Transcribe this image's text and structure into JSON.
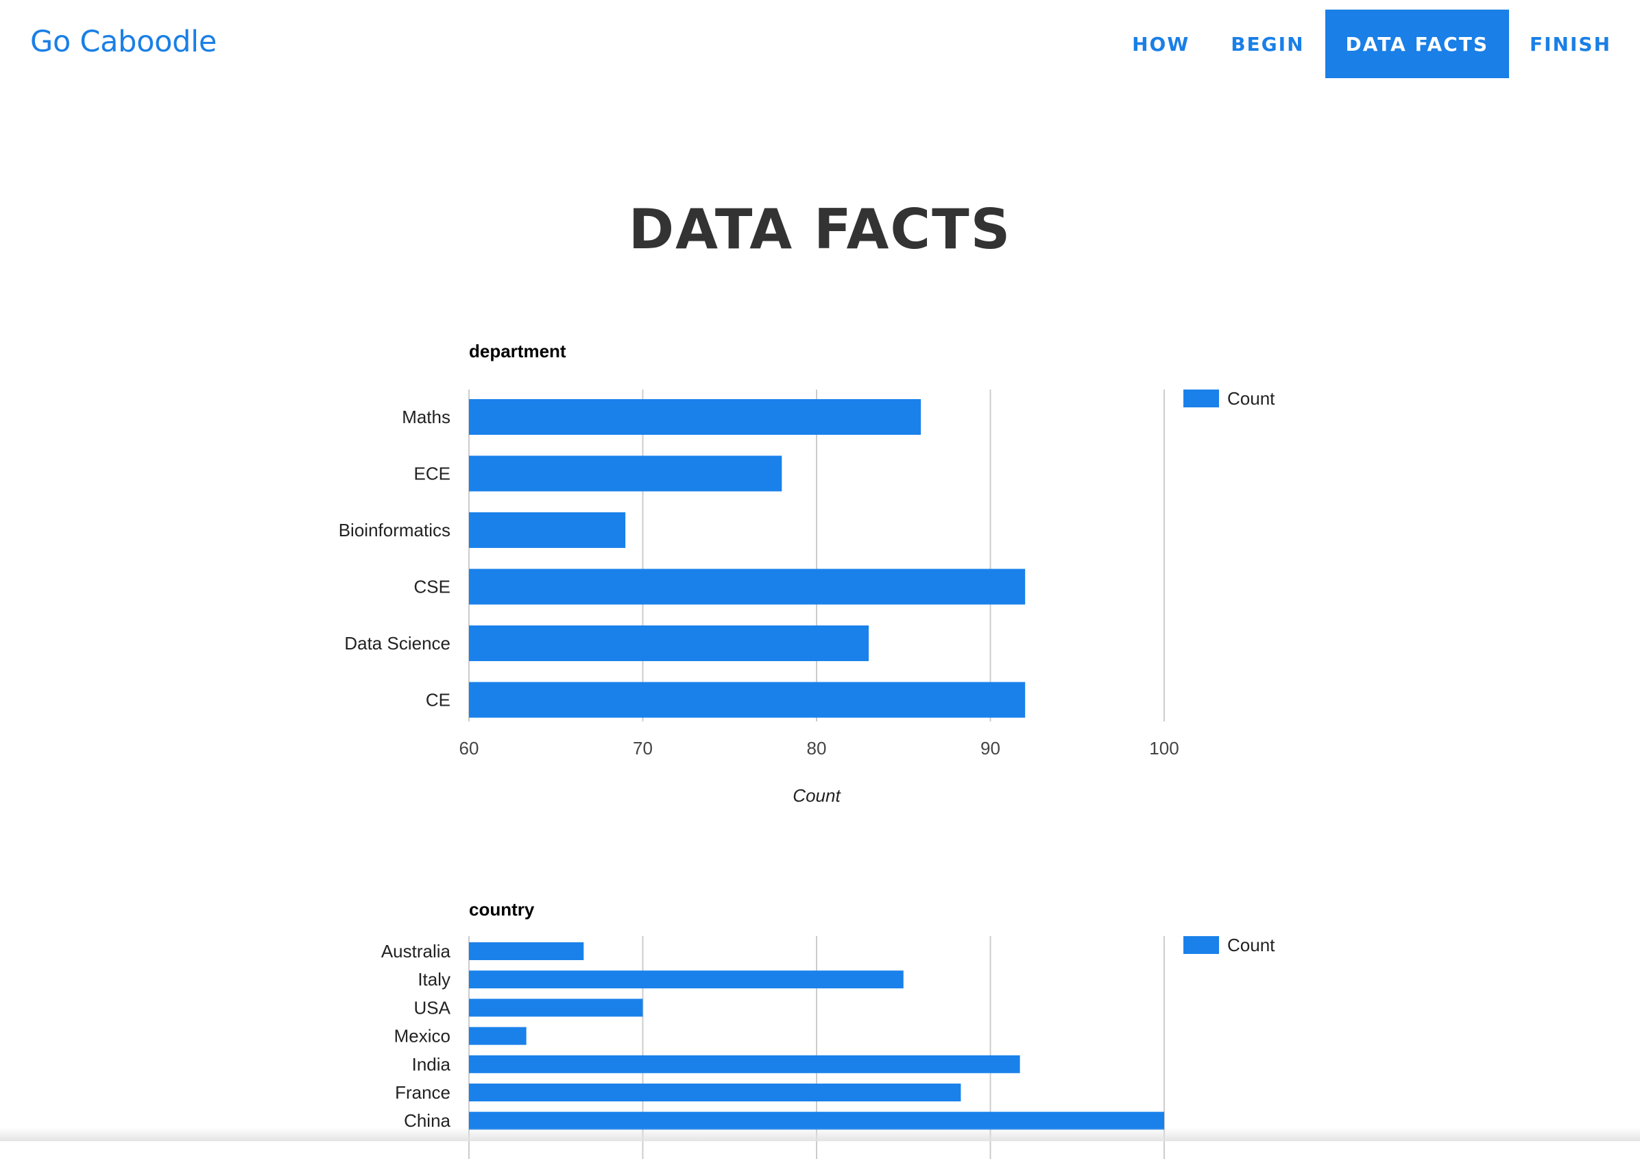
{
  "brand": "Go Caboodle",
  "nav": [
    {
      "label": "HOW",
      "active": false
    },
    {
      "label": "BEGIN",
      "active": false
    },
    {
      "label": "DATA FACTS",
      "active": true
    },
    {
      "label": "FINISH",
      "active": false
    }
  ],
  "page_title": "DATA FACTS",
  "colors": {
    "accent": "#1a7fe6",
    "bar": "#1a81ea",
    "grid": "#cccccc"
  },
  "chart_data": [
    {
      "type": "bar",
      "orientation": "horizontal",
      "title": "department",
      "categories": [
        "Maths",
        "ECE",
        "Bioinformatics",
        "CSE",
        "Data Science",
        "CE"
      ],
      "series": [
        {
          "name": "Count",
          "values": [
            86,
            78,
            69,
            92,
            83,
            92
          ]
        }
      ],
      "xlabel": "Count",
      "ylabel": "",
      "xlim": [
        60,
        100
      ],
      "xticks": [
        "60",
        "70",
        "80",
        "90",
        "100"
      ],
      "grid": true,
      "legend": "top-right"
    },
    {
      "type": "bar",
      "orientation": "horizontal",
      "title": "country",
      "categories": [
        "Australia",
        "Italy",
        "USA",
        "Mexico",
        "India",
        "France",
        "China"
      ],
      "series": [
        {
          "name": "Count",
          "values": [
            66.6,
            85,
            70,
            63.3,
            91.7,
            88.3,
            100
          ]
        }
      ],
      "xlim": [
        60,
        100
      ],
      "grid": true,
      "legend": "top-right"
    }
  ]
}
